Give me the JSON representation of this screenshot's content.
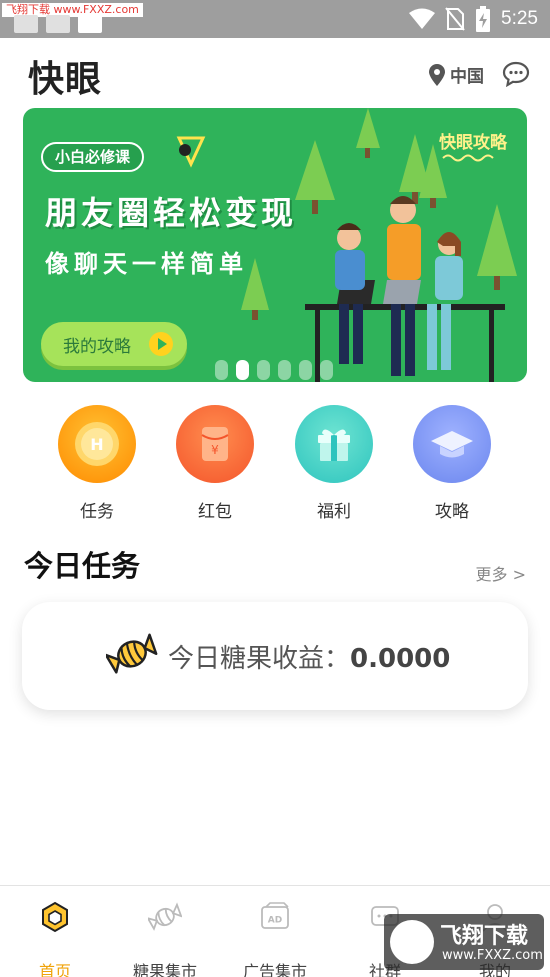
{
  "status_bar": {
    "watermark": "飞翔下载 www.FXXZ.com",
    "time": "5:25",
    "icons": [
      "wifi-icon",
      "no-sim-icon",
      "battery-charging-icon"
    ]
  },
  "header": {
    "title": "快眼",
    "location": "中国",
    "location_icon": "location-pin-icon",
    "message_icon": "chat-bubble-icon"
  },
  "banner": {
    "tag": "小白必修课",
    "headline": "朋友圈轻松变现",
    "subheadline": "像聊天一样简单",
    "brand": "快眼攻略",
    "cta": "我的攻略",
    "slides": 6,
    "active_slide": 2
  },
  "quick_actions": [
    {
      "label": "任务",
      "icon": "coin-icon",
      "color": "#ff9d1a"
    },
    {
      "label": "红包",
      "icon": "red-packet-icon",
      "color": "#ff6b3d"
    },
    {
      "label": "福利",
      "icon": "gift-icon",
      "color": "#36d0c8"
    },
    {
      "label": "攻略",
      "icon": "graduation-cap-icon",
      "color": "#6f8df5"
    }
  ],
  "today_tasks": {
    "title": "今日任务",
    "more": "更多 >",
    "earnings_label": "今日糖果收益：",
    "earnings_value": "0.0000",
    "candy_icon": "candy-icon"
  },
  "bottom_nav": [
    {
      "label": "首页",
      "icon": "home-hex-icon",
      "active": true
    },
    {
      "label": "糖果集市",
      "icon": "candy-outline-icon",
      "active": false
    },
    {
      "label": "广告集市",
      "icon": "ad-icon",
      "active": false
    },
    {
      "label": "社群",
      "icon": "community-chat-icon",
      "active": false
    },
    {
      "label": "我的",
      "icon": "profile-icon",
      "active": false
    }
  ],
  "watermark_logo": {
    "title": "飞翔下载",
    "url": "www.FXXZ.com"
  },
  "colors": {
    "banner_green": "#2fb35a",
    "accent_yellow": "#f0a30a",
    "status_bar": "#9e9e9e"
  }
}
